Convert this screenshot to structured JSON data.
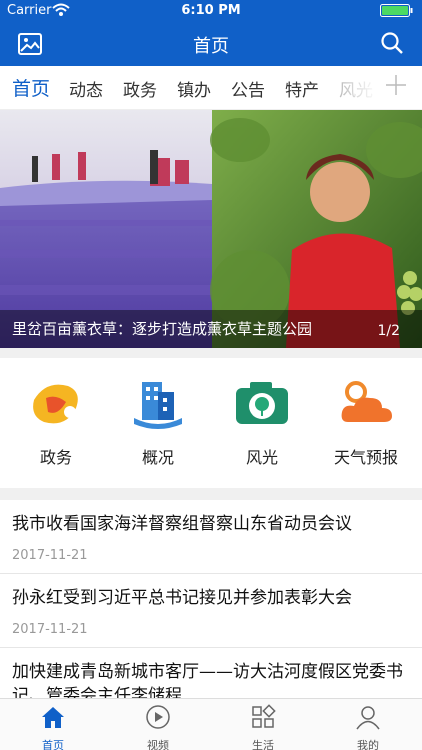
{
  "status_bar": {
    "carrier": "Carrier",
    "time": "6:10 PM"
  },
  "nav": {
    "title": "首页"
  },
  "tabs": [
    {
      "label": "首页",
      "active": true
    },
    {
      "label": "动态"
    },
    {
      "label": "政务"
    },
    {
      "label": "镇办"
    },
    {
      "label": "公告"
    },
    {
      "label": "特产"
    },
    {
      "label": "风光"
    }
  ],
  "banner": {
    "caption": "里岔百亩薰衣草：逐步打造成薰衣草主题公园",
    "pager": "1/2"
  },
  "quick_entries": [
    {
      "label": "政务",
      "icon": "government-icon"
    },
    {
      "label": "概况",
      "icon": "buildings-icon"
    },
    {
      "label": "风光",
      "icon": "camera-icon"
    },
    {
      "label": "天气预报",
      "icon": "weather-icon"
    }
  ],
  "news": [
    {
      "title": "我市收看国家海洋督察组督察山东省动员会议",
      "date": "2017-11-21"
    },
    {
      "title": "孙永红受到习近平总书记接见并参加表彰大会",
      "date": "2017-11-21"
    },
    {
      "title": "加快建成青岛新城市客厅——访大沽河度假区党委书记、管委会主任李储程",
      "date": ""
    }
  ],
  "tabbar": [
    {
      "label": "首页",
      "icon": "home-icon",
      "active": true
    },
    {
      "label": "视频",
      "icon": "play-icon"
    },
    {
      "label": "生活",
      "icon": "grid-icon"
    },
    {
      "label": "我的",
      "icon": "person-icon"
    }
  ],
  "colors": {
    "primary": "#1060c8",
    "tab_active": "#1060c8"
  }
}
